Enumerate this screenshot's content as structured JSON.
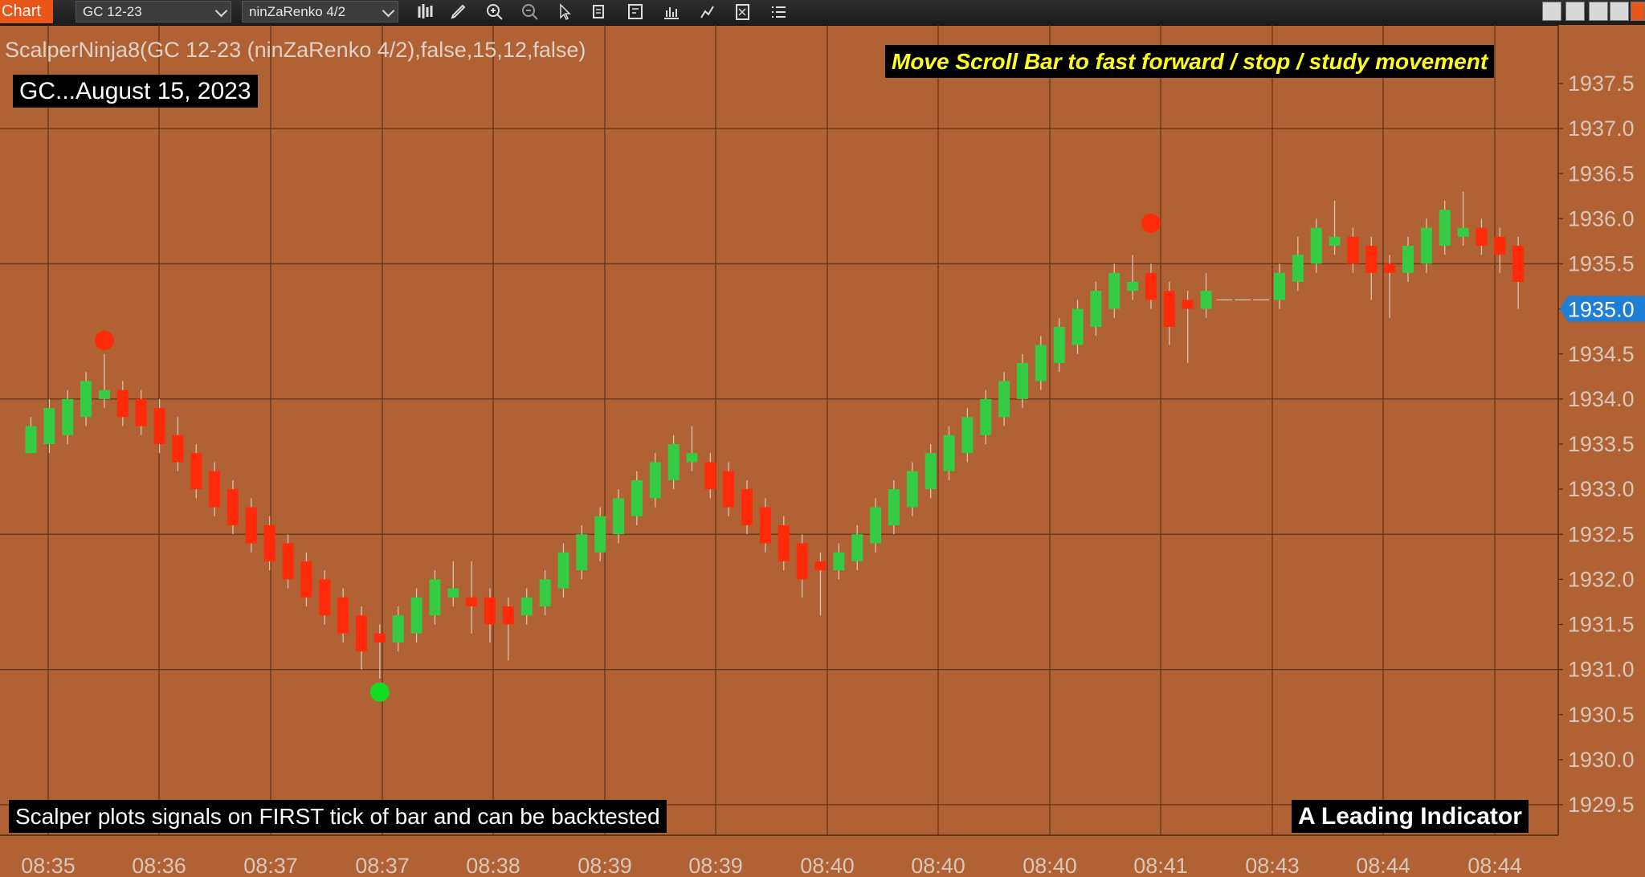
{
  "window": {
    "tab_label": "Chart",
    "instrument": "GC 12-23",
    "bar_type": "ninZaRenko 4/2",
    "toolbar_icons": [
      "bar-style-icon",
      "draw-pencil-icon",
      "zoom-in-icon",
      "zoom-out-icon",
      "pointer-icon",
      "data-box-icon",
      "template-icon",
      "indicators-icon",
      "strategy-icon",
      "properties-icon",
      "list-icon"
    ]
  },
  "overlays": {
    "indicator_label": "ScalperNinja8(GC 12-23 (ninZaRenko 4/2),false,15,12,false)",
    "symbol_date": "GC...August 15, 2023",
    "scroll_note": "Move Scroll Bar to fast forward / stop / study movement",
    "bottom_note": "Scalper plots signals on FIRST tick of bar and can be backtested",
    "leading_note": "A Leading Indicator"
  },
  "colors": {
    "background": "#b06234",
    "up_candle": "#33cc44",
    "down_candle": "#ff2a0a",
    "sell_dot": "#ff2a0a",
    "buy_dot": "#11dd22",
    "price_marker": "#1e7fd6",
    "grid": "#5e3219",
    "axis_text": "#d8c6b8"
  },
  "chart_data": {
    "type": "candlestick",
    "y_axis": {
      "ticks": [
        "1937.5",
        "1937.0",
        "1936.5",
        "1936.0",
        "1935.5",
        "1935.0",
        "1934.5",
        "1934.0",
        "1933.5",
        "1933.0",
        "1932.5",
        "1932.0",
        "1931.5",
        "1931.0",
        "1930.5",
        "1930.0",
        "1929.5"
      ],
      "ylim": [
        1929.3,
        1937.8
      ],
      "current_price": "1935.0"
    },
    "x_axis": {
      "ticks": [
        "08:35",
        "08:36",
        "08:37",
        "08:37",
        "08:38",
        "08:39",
        "08:39",
        "08:40",
        "08:40",
        "08:40",
        "08:41",
        "08:43",
        "08:44",
        "08:44"
      ]
    },
    "candles": [
      {
        "o": 1933.4,
        "c": 1933.7,
        "h": 1933.8,
        "l": 1933.4
      },
      {
        "o": 1933.5,
        "c": 1933.9,
        "h": 1934.0,
        "l": 1933.4
      },
      {
        "o": 1933.6,
        "c": 1934.0,
        "h": 1934.1,
        "l": 1933.5
      },
      {
        "o": 1933.8,
        "c": 1934.2,
        "h": 1934.3,
        "l": 1933.7
      },
      {
        "o": 1934.0,
        "c": 1934.1,
        "h": 1934.5,
        "l": 1933.9
      },
      {
        "o": 1934.1,
        "c": 1933.8,
        "h": 1934.2,
        "l": 1933.7
      },
      {
        "o": 1934.0,
        "c": 1933.7,
        "h": 1934.1,
        "l": 1933.6
      },
      {
        "o": 1933.9,
        "c": 1933.5,
        "h": 1934.0,
        "l": 1933.4
      },
      {
        "o": 1933.6,
        "c": 1933.3,
        "h": 1933.8,
        "l": 1933.2
      },
      {
        "o": 1933.4,
        "c": 1933.0,
        "h": 1933.5,
        "l": 1932.9
      },
      {
        "o": 1933.2,
        "c": 1932.8,
        "h": 1933.3,
        "l": 1932.7
      },
      {
        "o": 1933.0,
        "c": 1932.6,
        "h": 1933.1,
        "l": 1932.5
      },
      {
        "o": 1932.8,
        "c": 1932.4,
        "h": 1932.9,
        "l": 1932.3
      },
      {
        "o": 1932.6,
        "c": 1932.2,
        "h": 1932.7,
        "l": 1932.1
      },
      {
        "o": 1932.4,
        "c": 1932.0,
        "h": 1932.5,
        "l": 1931.9
      },
      {
        "o": 1932.2,
        "c": 1931.8,
        "h": 1932.3,
        "l": 1931.7
      },
      {
        "o": 1932.0,
        "c": 1931.6,
        "h": 1932.1,
        "l": 1931.5
      },
      {
        "o": 1931.8,
        "c": 1931.4,
        "h": 1931.9,
        "l": 1931.3
      },
      {
        "o": 1931.6,
        "c": 1931.2,
        "h": 1931.7,
        "l": 1931.0
      },
      {
        "o": 1931.4,
        "c": 1931.3,
        "h": 1931.5,
        "l": 1930.9
      },
      {
        "o": 1931.3,
        "c": 1931.6,
        "h": 1931.7,
        "l": 1931.2
      },
      {
        "o": 1931.4,
        "c": 1931.8,
        "h": 1931.9,
        "l": 1931.3
      },
      {
        "o": 1931.6,
        "c": 1932.0,
        "h": 1932.1,
        "l": 1931.5
      },
      {
        "o": 1931.8,
        "c": 1931.9,
        "h": 1932.2,
        "l": 1931.7
      },
      {
        "o": 1931.8,
        "c": 1931.7,
        "h": 1932.2,
        "l": 1931.4
      },
      {
        "o": 1931.8,
        "c": 1931.5,
        "h": 1931.9,
        "l": 1931.3
      },
      {
        "o": 1931.7,
        "c": 1931.5,
        "h": 1931.8,
        "l": 1931.1
      },
      {
        "o": 1931.6,
        "c": 1931.8,
        "h": 1931.9,
        "l": 1931.5
      },
      {
        "o": 1931.7,
        "c": 1932.0,
        "h": 1932.1,
        "l": 1931.6
      },
      {
        "o": 1931.9,
        "c": 1932.3,
        "h": 1932.4,
        "l": 1931.8
      },
      {
        "o": 1932.1,
        "c": 1932.5,
        "h": 1932.6,
        "l": 1932.0
      },
      {
        "o": 1932.3,
        "c": 1932.7,
        "h": 1932.8,
        "l": 1932.2
      },
      {
        "o": 1932.5,
        "c": 1932.9,
        "h": 1933.0,
        "l": 1932.4
      },
      {
        "o": 1932.7,
        "c": 1933.1,
        "h": 1933.2,
        "l": 1932.6
      },
      {
        "o": 1932.9,
        "c": 1933.3,
        "h": 1933.4,
        "l": 1932.8
      },
      {
        "o": 1933.1,
        "c": 1933.5,
        "h": 1933.6,
        "l": 1933.0
      },
      {
        "o": 1933.3,
        "c": 1933.4,
        "h": 1933.7,
        "l": 1933.2
      },
      {
        "o": 1933.3,
        "c": 1933.0,
        "h": 1933.4,
        "l": 1932.9
      },
      {
        "o": 1933.2,
        "c": 1932.8,
        "h": 1933.3,
        "l": 1932.7
      },
      {
        "o": 1933.0,
        "c": 1932.6,
        "h": 1933.1,
        "l": 1932.5
      },
      {
        "o": 1932.8,
        "c": 1932.4,
        "h": 1932.9,
        "l": 1932.3
      },
      {
        "o": 1932.6,
        "c": 1932.2,
        "h": 1932.7,
        "l": 1932.1
      },
      {
        "o": 1932.4,
        "c": 1932.0,
        "h": 1932.5,
        "l": 1931.8
      },
      {
        "o": 1932.2,
        "c": 1932.1,
        "h": 1932.3,
        "l": 1931.6
      },
      {
        "o": 1932.1,
        "c": 1932.3,
        "h": 1932.4,
        "l": 1932.0
      },
      {
        "o": 1932.2,
        "c": 1932.5,
        "h": 1932.6,
        "l": 1932.1
      },
      {
        "o": 1932.4,
        "c": 1932.8,
        "h": 1932.9,
        "l": 1932.3
      },
      {
        "o": 1932.6,
        "c": 1933.0,
        "h": 1933.1,
        "l": 1932.5
      },
      {
        "o": 1932.8,
        "c": 1933.2,
        "h": 1933.3,
        "l": 1932.7
      },
      {
        "o": 1933.0,
        "c": 1933.4,
        "h": 1933.5,
        "l": 1932.9
      },
      {
        "o": 1933.2,
        "c": 1933.6,
        "h": 1933.7,
        "l": 1933.1
      },
      {
        "o": 1933.4,
        "c": 1933.8,
        "h": 1933.9,
        "l": 1933.3
      },
      {
        "o": 1933.6,
        "c": 1934.0,
        "h": 1934.1,
        "l": 1933.5
      },
      {
        "o": 1933.8,
        "c": 1934.2,
        "h": 1934.3,
        "l": 1933.7
      },
      {
        "o": 1934.0,
        "c": 1934.4,
        "h": 1934.5,
        "l": 1933.9
      },
      {
        "o": 1934.2,
        "c": 1934.6,
        "h": 1934.7,
        "l": 1934.1
      },
      {
        "o": 1934.4,
        "c": 1934.8,
        "h": 1934.9,
        "l": 1934.3
      },
      {
        "o": 1934.6,
        "c": 1935.0,
        "h": 1935.1,
        "l": 1934.5
      },
      {
        "o": 1934.8,
        "c": 1935.2,
        "h": 1935.3,
        "l": 1934.7
      },
      {
        "o": 1935.0,
        "c": 1935.4,
        "h": 1935.5,
        "l": 1934.9
      },
      {
        "o": 1935.2,
        "c": 1935.3,
        "h": 1935.6,
        "l": 1935.1
      },
      {
        "o": 1935.4,
        "c": 1935.1,
        "h": 1935.5,
        "l": 1935.0
      },
      {
        "o": 1935.2,
        "c": 1934.8,
        "h": 1935.3,
        "l": 1934.6
      },
      {
        "o": 1935.1,
        "c": 1935.0,
        "h": 1935.2,
        "l": 1934.4
      },
      {
        "o": 1935.0,
        "c": 1935.2,
        "h": 1935.4,
        "l": 1934.9
      },
      {
        "o": 1935.1,
        "c": 1935.1,
        "h": 1935.1,
        "l": 1935.1
      },
      {
        "o": 1935.1,
        "c": 1935.1,
        "h": 1935.1,
        "l": 1935.1
      },
      {
        "o": 1935.1,
        "c": 1935.1,
        "h": 1935.1,
        "l": 1935.1
      },
      {
        "o": 1935.1,
        "c": 1935.4,
        "h": 1935.5,
        "l": 1935.0
      },
      {
        "o": 1935.3,
        "c": 1935.6,
        "h": 1935.8,
        "l": 1935.2
      },
      {
        "o": 1935.5,
        "c": 1935.9,
        "h": 1936.0,
        "l": 1935.4
      },
      {
        "o": 1935.7,
        "c": 1935.8,
        "h": 1936.2,
        "l": 1935.6
      },
      {
        "o": 1935.8,
        "c": 1935.5,
        "h": 1935.9,
        "l": 1935.4
      },
      {
        "o": 1935.7,
        "c": 1935.4,
        "h": 1935.8,
        "l": 1935.1
      },
      {
        "o": 1935.5,
        "c": 1935.4,
        "h": 1935.6,
        "l": 1934.9
      },
      {
        "o": 1935.4,
        "c": 1935.7,
        "h": 1935.8,
        "l": 1935.3
      },
      {
        "o": 1935.5,
        "c": 1935.9,
        "h": 1936.0,
        "l": 1935.4
      },
      {
        "o": 1935.7,
        "c": 1936.1,
        "h": 1936.2,
        "l": 1935.6
      },
      {
        "o": 1935.8,
        "c": 1935.9,
        "h": 1936.3,
        "l": 1935.7
      },
      {
        "o": 1935.9,
        "c": 1935.7,
        "h": 1936.0,
        "l": 1935.6
      },
      {
        "o": 1935.8,
        "c": 1935.6,
        "h": 1935.9,
        "l": 1935.4
      },
      {
        "o": 1935.7,
        "c": 1935.3,
        "h": 1935.8,
        "l": 1935.0
      }
    ],
    "signals": [
      {
        "bar": 4,
        "type": "sell",
        "price": 1934.65
      },
      {
        "bar": 19,
        "type": "buy",
        "price": 1930.75
      },
      {
        "bar": 61,
        "type": "sell",
        "price": 1935.95
      }
    ]
  }
}
